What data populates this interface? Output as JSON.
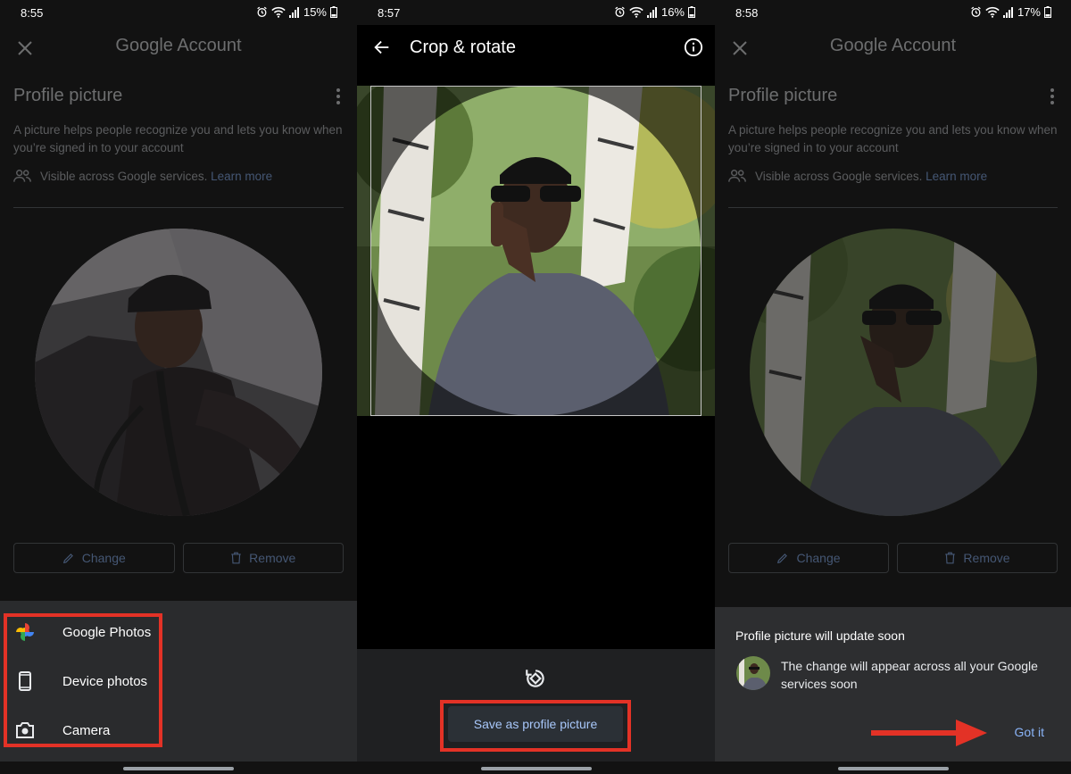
{
  "panels": [
    {
      "status": {
        "time": "8:55",
        "battery": "15%"
      },
      "app_title": "Google Account",
      "section_title": "Profile picture",
      "description": "A picture helps people recognize you and lets you know when you’re signed in to your account",
      "visibility_text": "Visible across Google services.",
      "learn_more": "Learn more",
      "change_label": "Change",
      "remove_label": "Remove",
      "sheet_items": [
        {
          "label": "Google Photos",
          "icon": "google-photos-icon"
        },
        {
          "label": "Device photos",
          "icon": "phone-icon"
        },
        {
          "label": "Camera",
          "icon": "camera-icon"
        }
      ]
    },
    {
      "status": {
        "time": "8:57",
        "battery": "16%"
      },
      "title": "Crop & rotate",
      "save_label": "Save as profile picture"
    },
    {
      "status": {
        "time": "8:58",
        "battery": "17%"
      },
      "app_title": "Google Account",
      "section_title": "Profile picture",
      "description": "A picture helps people recognize you and lets you know when you’re signed in to your account",
      "visibility_text": "Visible across Google services.",
      "learn_more": "Learn more",
      "change_label": "Change",
      "remove_label": "Remove",
      "dialog": {
        "title": "Profile picture will update soon",
        "body": "The change will appear across all your Google services soon",
        "action": "Got it"
      }
    }
  ],
  "colors": {
    "accent": "#8ab4f8",
    "highlight": "#e33226",
    "background": "#121212"
  }
}
